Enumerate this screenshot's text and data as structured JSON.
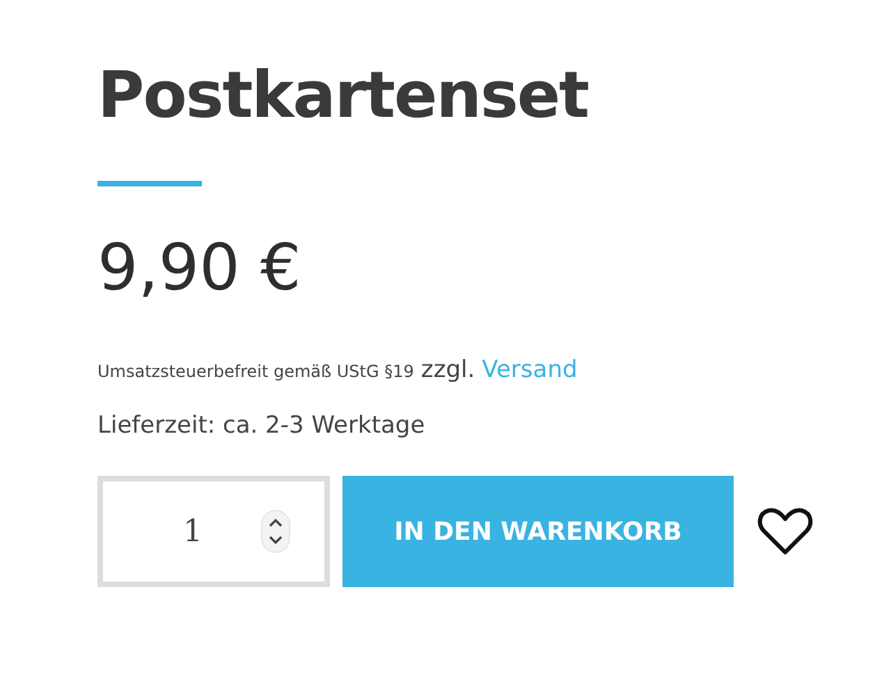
{
  "product": {
    "title": "Postkartenset",
    "price": "9,90 €",
    "tax_note": "Umsatzsteuerbefreit gemäß UStG §19",
    "shipping_prefix": "zzgl.",
    "shipping_link": "Versand",
    "delivery": "Lieferzeit: ca. 2-3 Werktage"
  },
  "purchase": {
    "quantity": "1",
    "button": "IN DEN WARENKORB"
  }
}
